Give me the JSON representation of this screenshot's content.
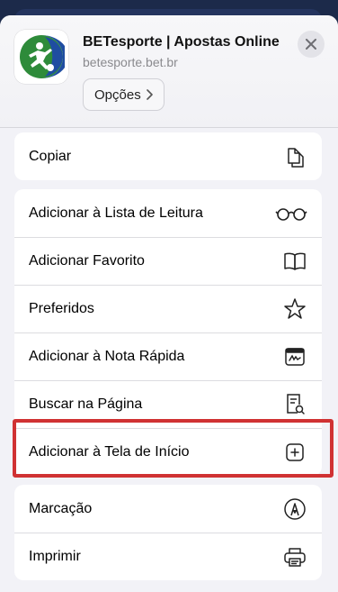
{
  "header": {
    "title": "BETesporte | Apostas Online",
    "subtitle": "betesporte.bet.br",
    "options_label": "Opções"
  },
  "groups": [
    {
      "items": [
        {
          "label": "Copiar",
          "icon": "copy-icon"
        }
      ]
    },
    {
      "items": [
        {
          "label": "Adicionar à Lista de Leitura",
          "icon": "glasses-icon"
        },
        {
          "label": "Adicionar Favorito",
          "icon": "book-icon"
        },
        {
          "label": "Preferidos",
          "icon": "star-icon"
        },
        {
          "label": "Adicionar à Nota Rápida",
          "icon": "quick-note-icon"
        },
        {
          "label": "Buscar na Página",
          "icon": "find-in-page-icon"
        },
        {
          "label": "Adicionar à Tela de Início",
          "icon": "add-square-icon"
        }
      ]
    },
    {
      "items": [
        {
          "label": "Marcação",
          "icon": "markup-icon"
        },
        {
          "label": "Imprimir",
          "icon": "printer-icon"
        }
      ]
    }
  ],
  "colors": {
    "highlight": "#d03233",
    "sheet_bg": "#f2f2f7",
    "logo_green": "#2e8b3a",
    "logo_blue": "#1f4da1"
  }
}
